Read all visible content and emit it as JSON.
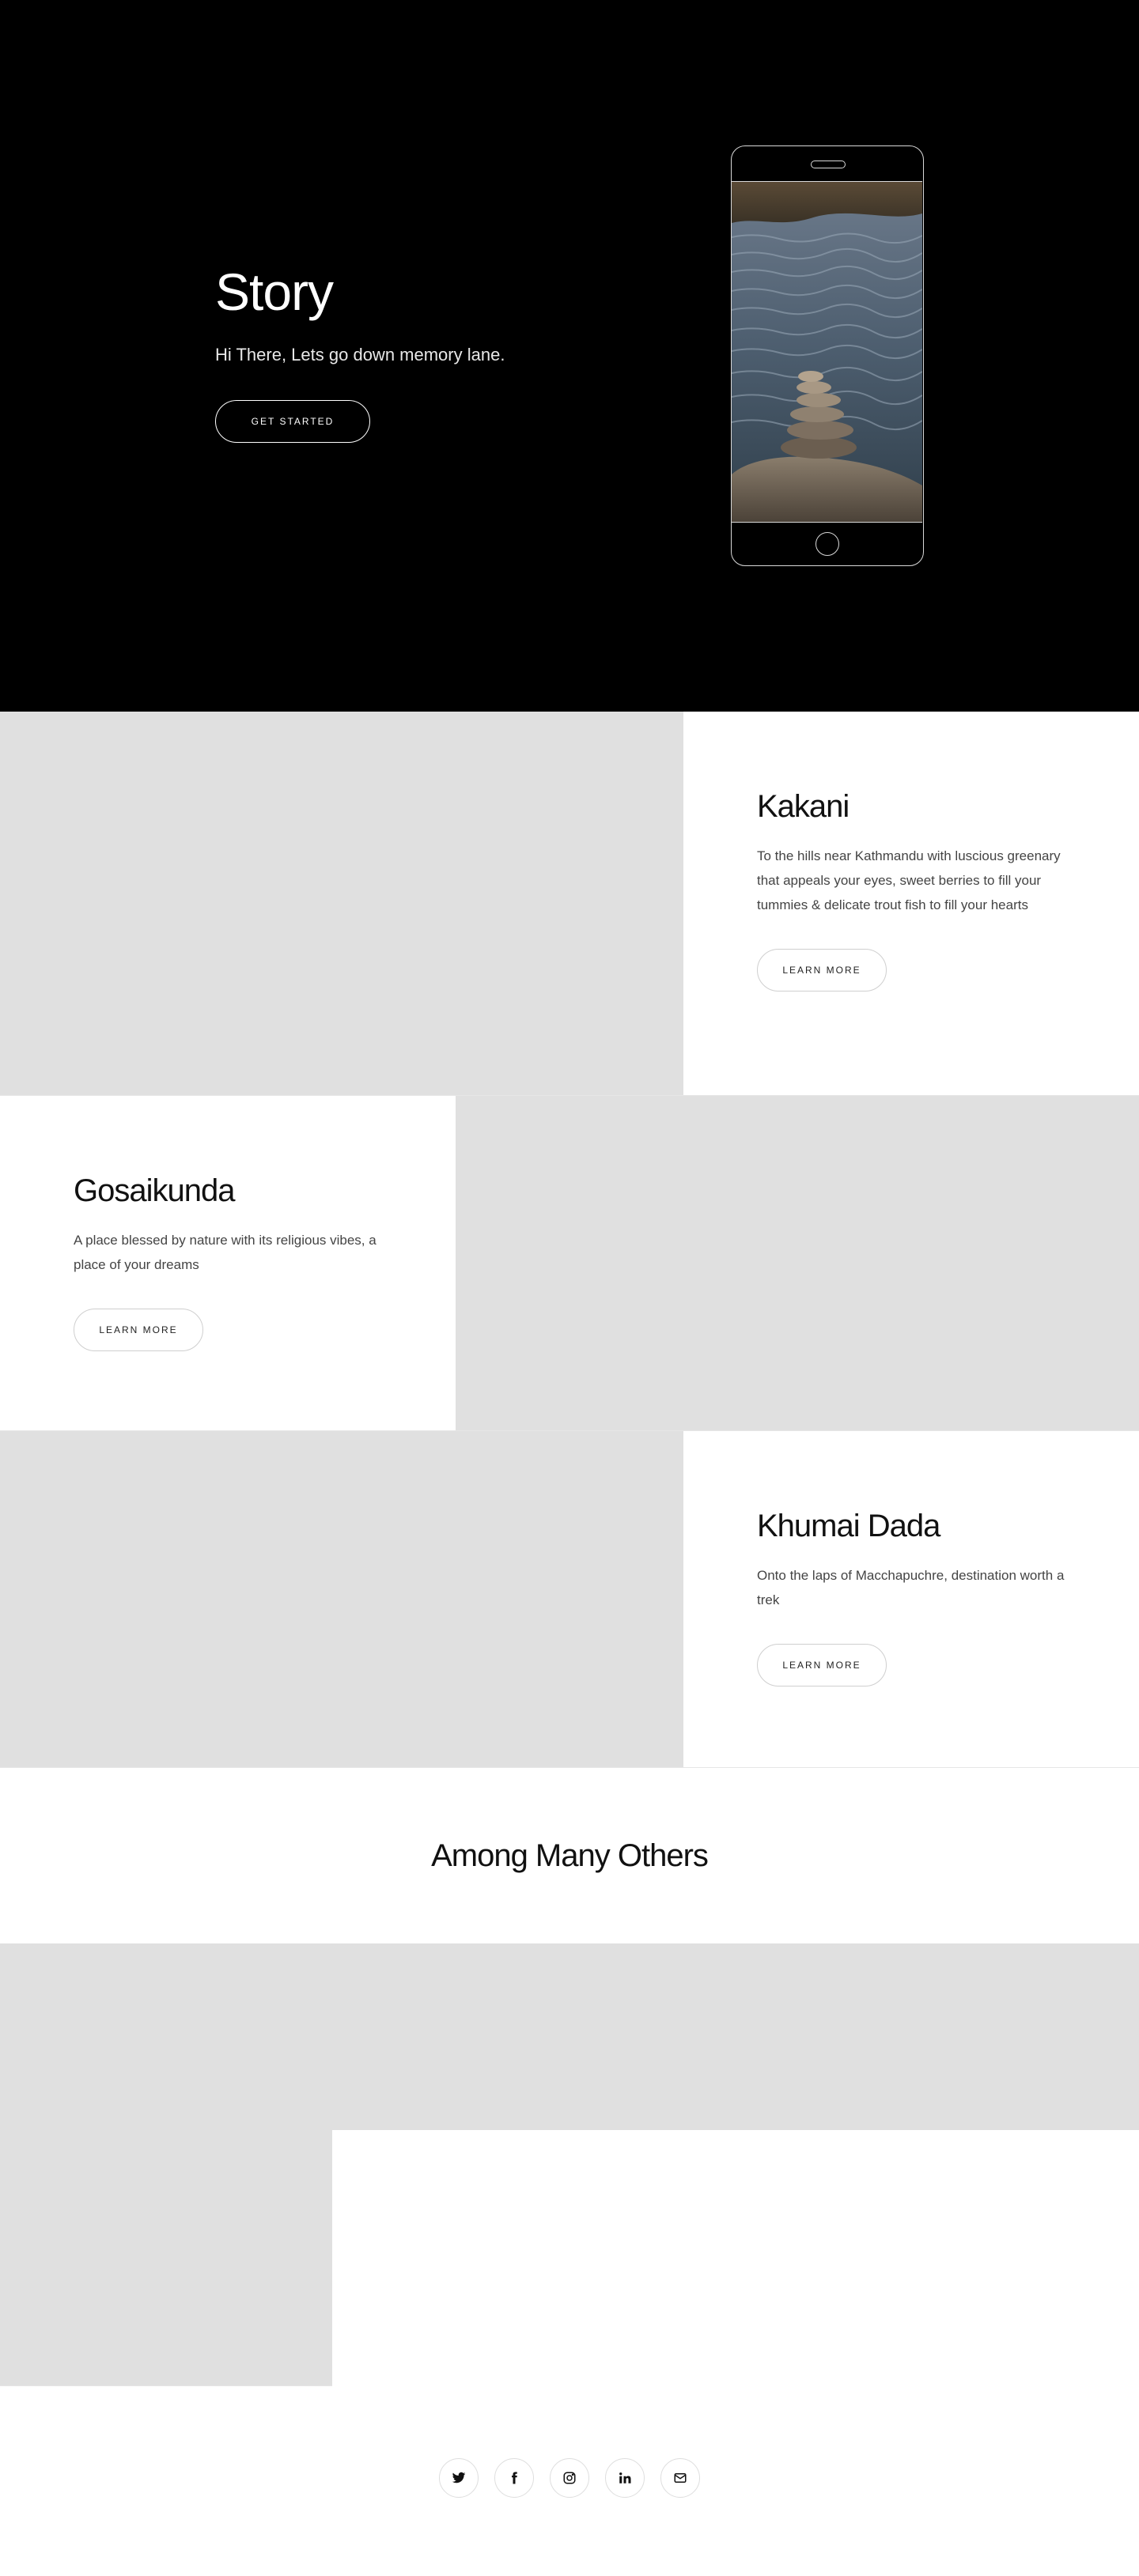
{
  "hero": {
    "title": "Story",
    "subtitle": "Hi There, Lets go down memory lane.",
    "cta_label": "GET STARTED"
  },
  "features": [
    {
      "title": "Kakani",
      "description": "To the hills near Kathmandu with luscious greenary that appeals your eyes, sweet berries to fill your tummies & delicate trout fish to fill your hearts",
      "button_label": "LEARN MORE"
    },
    {
      "title": "Gosaikunda",
      "description": "A place blessed by nature with its religious vibes, a place of your dreams",
      "button_label": "LEARN MORE"
    },
    {
      "title": "Khumai Dada",
      "description": "Onto the laps of Macchapuchre, destination worth a trek",
      "button_label": "LEARN MORE"
    }
  ],
  "among": {
    "title": "Among Many Others"
  },
  "footer": {
    "social_icons": [
      "twitter-icon",
      "facebook-icon",
      "instagram-icon",
      "linkedin-icon",
      "email-icon"
    ]
  },
  "colors": {
    "hero_bg": "#000000",
    "placeholder_gray": "#e0e0e0",
    "text_dark": "#111111"
  }
}
